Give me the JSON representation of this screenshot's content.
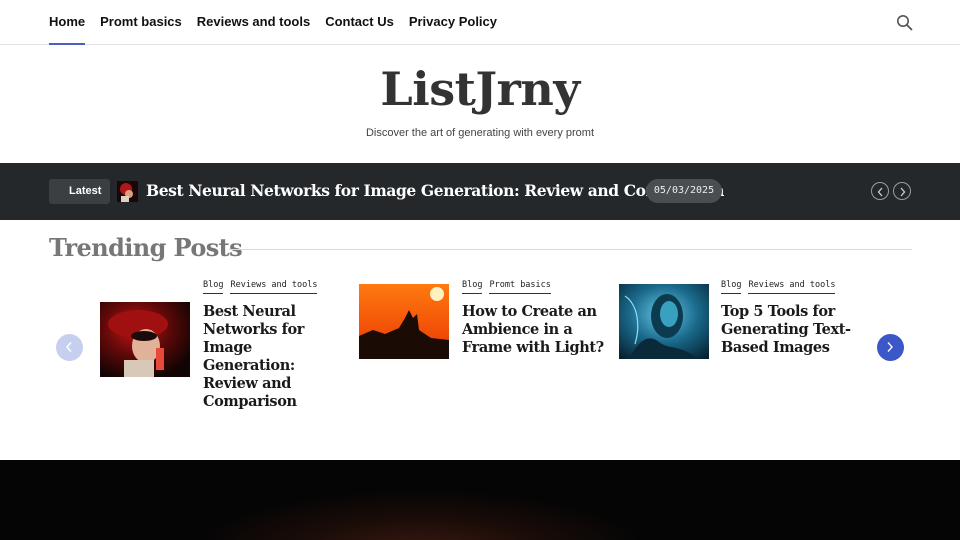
{
  "nav": {
    "items": [
      {
        "label": "Home",
        "active": true
      },
      {
        "label": "Promt basics"
      },
      {
        "label": "Reviews and tools"
      },
      {
        "label": "Contact Us"
      },
      {
        "label": "Privacy Policy"
      }
    ],
    "search_icon": "search-icon"
  },
  "header": {
    "brand": "ListJrny",
    "tagline": "Discover the art of generating with every promt"
  },
  "ticker": {
    "badge": "Latest",
    "title": "Best Neural Networks for Image Generation: Review and Comparison",
    "date": "05/03/2025"
  },
  "trending": {
    "title": "Trending Posts",
    "posts": [
      {
        "tags": [
          "Blog",
          "Reviews and tools"
        ],
        "title": "Best Neural Networks for Image Generation: Review and Comparison"
      },
      {
        "tags": [
          "Blog",
          "Promt basics"
        ],
        "title": "How to Create an Ambience in a Frame with Light?"
      },
      {
        "tags": [
          "Blog",
          "Reviews and tools"
        ],
        "title": "Top 5 Tools for Generating Text-Based Images"
      }
    ]
  },
  "colors": {
    "accent": "#3b57c8",
    "ticker_bg": "#25282b"
  }
}
